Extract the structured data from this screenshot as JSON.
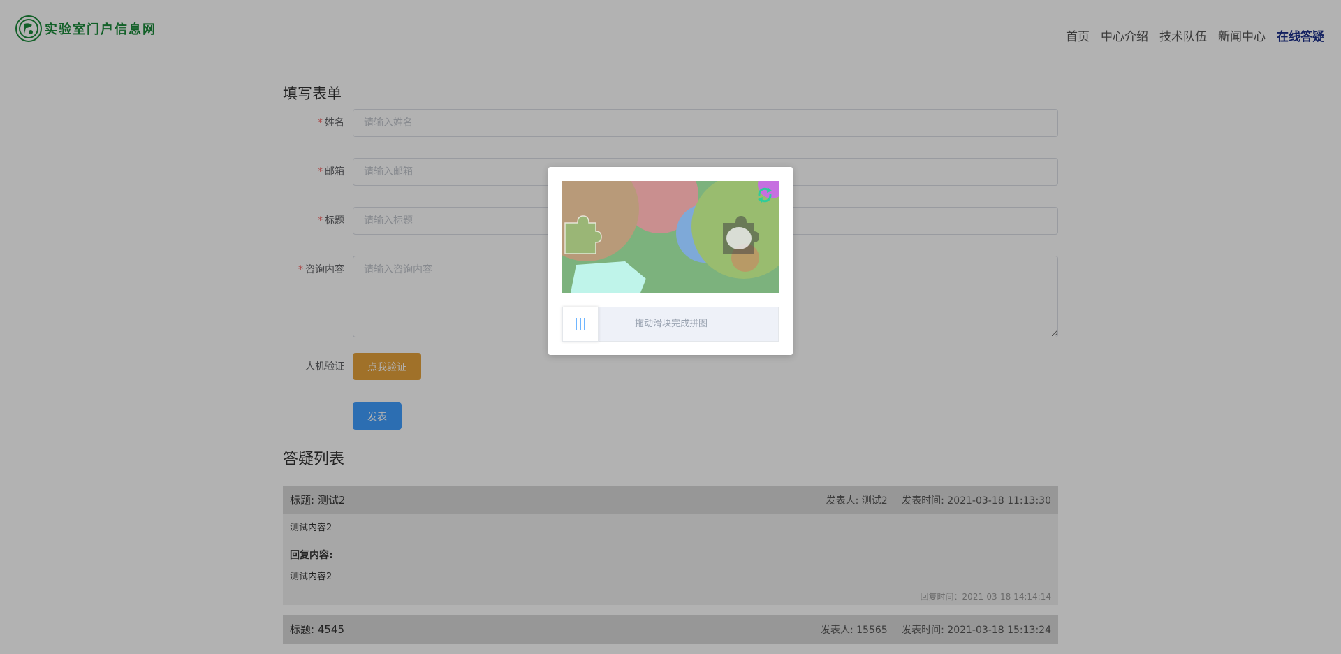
{
  "header": {
    "logo_text": "实验室门户信息网",
    "nav": [
      "首页",
      "中心介绍",
      "技术队伍",
      "新闻中心",
      "在线答疑"
    ],
    "active_nav": "在线答疑"
  },
  "form": {
    "title": "填写表单",
    "fields": {
      "name": {
        "label": "姓名",
        "placeholder": "请输入姓名"
      },
      "email": {
        "label": "邮箱",
        "placeholder": "请输入邮箱"
      },
      "subject": {
        "label": "标题",
        "placeholder": "请输入标题"
      },
      "content": {
        "label": "咨询内容",
        "placeholder": "请输入咨询内容"
      }
    },
    "required_mark": "*",
    "captcha_label": "人机验证",
    "captcha_button": "点我验证",
    "submit_button": "发表"
  },
  "list": {
    "title": "答疑列表",
    "items": [
      {
        "title": "标题: 测试2",
        "author": "发表人: 测试2",
        "time": "发表时间: 2021-03-18 11:13:30",
        "content": "测试内容2",
        "reply_label": "回复内容:",
        "reply": "测试内容2",
        "reply_time": "回复时间：2021-03-18 14:14:14"
      },
      {
        "title": "标题: 4545",
        "author": "发表人: 15565",
        "time": "发表时间: 2021-03-18 15:13:24"
      }
    ]
  },
  "captcha": {
    "slider_text": "拖动滑块完成拼图",
    "handle_icon": "grip-lines-icon",
    "refresh_icon": "refresh-icon"
  },
  "colors": {
    "brand_green": "#1b8a3a",
    "nav_active": "#1a2f8a",
    "verify_button": "#e6a23c",
    "submit_button": "#409eff",
    "required": "#f56c6c"
  }
}
